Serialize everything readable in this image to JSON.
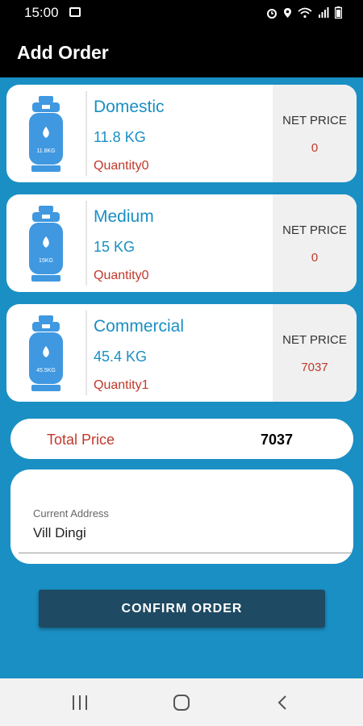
{
  "status": {
    "time": "15:00"
  },
  "appbar": {
    "title": "Add Order"
  },
  "products": [
    {
      "name": "Domestic",
      "weight": "11.8 KG",
      "quantity": "Quantity0",
      "price_label": "NET PRICE",
      "price": "0",
      "cylinder_label": "11.8KG"
    },
    {
      "name": "Medium",
      "weight": "15 KG",
      "quantity": "Quantity0",
      "price_label": "NET PRICE",
      "price": "0",
      "cylinder_label": "15KG"
    },
    {
      "name": "Commercial",
      "weight": "45.4 KG",
      "quantity": "Quantity1",
      "price_label": "NET PRICE",
      "price": "7037",
      "cylinder_label": "45.5KG"
    }
  ],
  "total": {
    "label": "Total Price",
    "value": "7037"
  },
  "address": {
    "label": "Current Address",
    "value": "Vill Dingi"
  },
  "confirm_label": "CONFIRM ORDER",
  "colors": {
    "background": "#1a8fc4",
    "accent_text": "#1a8fc4",
    "price_text": "#c0392b",
    "button": "#1e4a63",
    "cylinder": "#3f98e0"
  },
  "icons": [
    "gallery-icon",
    "alarm-icon",
    "location-icon",
    "wifi-icon",
    "signal-icon",
    "battery-icon",
    "gas-cylinder-icon",
    "recent-apps-icon",
    "home-icon",
    "back-icon"
  ]
}
